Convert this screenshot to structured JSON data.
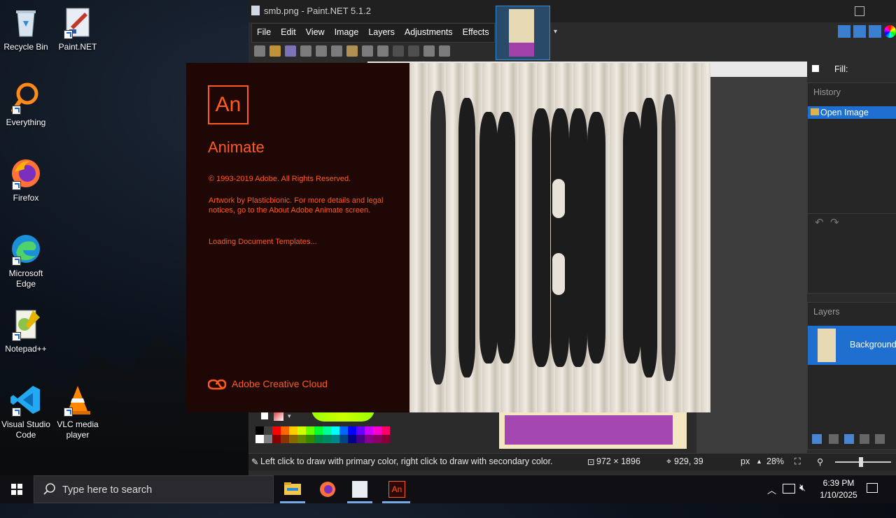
{
  "desktop": {
    "icons": [
      {
        "label": "Recycle Bin"
      },
      {
        "label": "Paint.NET"
      },
      {
        "label": "Everything"
      },
      {
        "label": "Firefox"
      },
      {
        "label": "Microsoft Edge"
      },
      {
        "label": "Notepad++"
      },
      {
        "label": "Visual Studio Code"
      },
      {
        "label": "VLC media player"
      }
    ]
  },
  "paintnet": {
    "title": "smb.png - Paint.NET 5.1.2",
    "menu": [
      "File",
      "Edit",
      "View",
      "Image",
      "Layers",
      "Adjustments",
      "Effects"
    ],
    "fill_label": "Fill:",
    "history": {
      "header": "History",
      "items": [
        "Open Image"
      ]
    },
    "layers": {
      "header": "Layers",
      "items": [
        "Background"
      ]
    },
    "status": {
      "hint": "Left click to draw with primary color, right click to draw with secondary color.",
      "size": "972 × 1896",
      "cursor": "929, 39",
      "unit": "px",
      "zoom": "28%"
    }
  },
  "splash": {
    "logo": "An",
    "app_name": "Animate",
    "copyright": "© 1993-2019 Adobe. All Rights Reserved.",
    "artwork": "Artwork by Plasticbionic. For more details and legal notices, go to the About Adobe Animate screen.",
    "loading": "Loading Document Templates...",
    "brand": "Adobe Creative Cloud"
  },
  "taskbar": {
    "search_placeholder": "Type here to search",
    "time": "6:39 PM",
    "date": "1/10/2025"
  },
  "colors": {
    "accent": "#ff5a1f",
    "selection": "#1e6fd0"
  }
}
